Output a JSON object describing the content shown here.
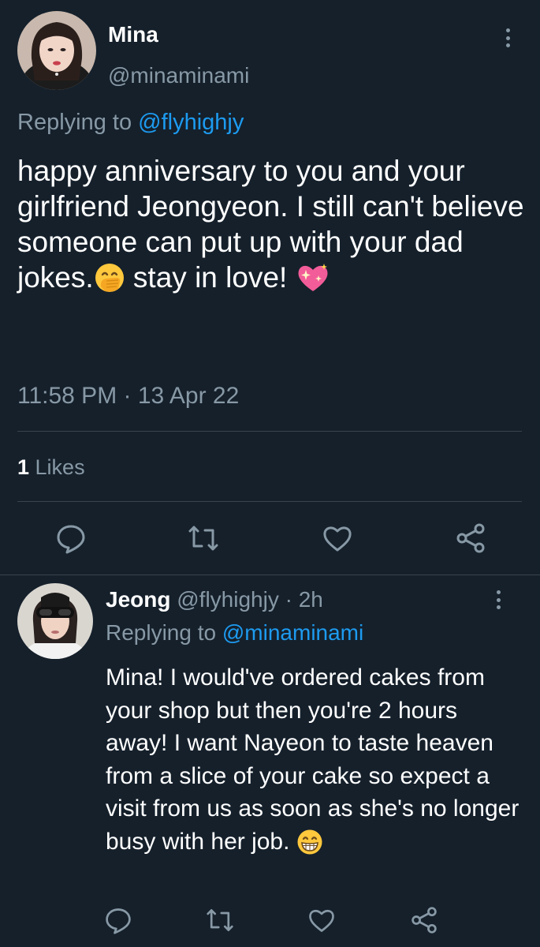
{
  "main_tweet": {
    "display_name": "Mina",
    "handle": "@minaminami",
    "replying_prefix": "Replying to ",
    "replying_to": "@flyhighjy",
    "text_part1": "happy anniversary to you and your girlfriend Jeongyeon. I still can't believe someone can put up with your dad jokes.",
    "emoji1": "face-with-hand-over-mouth-emoji",
    "text_part2": " stay in love! ",
    "emoji2": "sparkling-heart-emoji",
    "timestamp": "11:58 PM · 13 Apr 22",
    "likes_count": "1",
    "likes_label": " Likes",
    "actions": [
      "reply-icon",
      "retweet-icon",
      "like-icon",
      "share-icon"
    ]
  },
  "reply_tweet": {
    "display_name": "Jeong",
    "handle": " @flyhighjy",
    "time": " · 2h",
    "replying_prefix": "Replying to ",
    "replying_to": "@minaminami",
    "text": "Mina! I would've ordered cakes from your shop but then you're 2 hours away! I want Nayeon to taste heaven from a slice of your cake so expect a visit from us as soon as she's no longer busy with her job. ",
    "emoji": "grinning-face-with-smiling-eyes-emoji",
    "actions": [
      "reply-icon",
      "retweet-icon",
      "like-icon",
      "share-icon"
    ]
  },
  "colors": {
    "background": "#15202b",
    "text_primary": "#ffffff",
    "text_secondary": "#8899a6",
    "link": "#1d9bf0",
    "divider": "#38444d"
  }
}
